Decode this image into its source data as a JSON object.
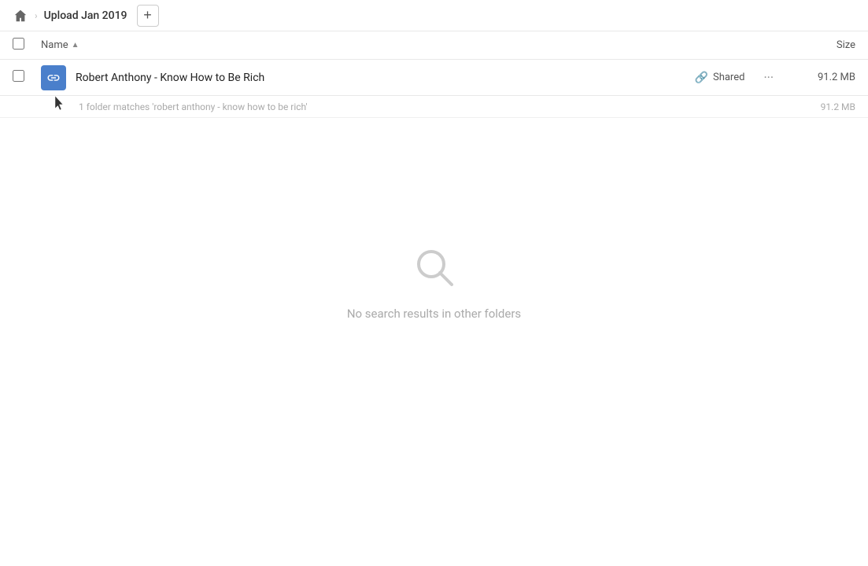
{
  "header": {
    "home_icon": "home",
    "breadcrumb": "Upload Jan 2019",
    "add_button_label": "+"
  },
  "columns": {
    "name_label": "Name",
    "size_label": "Size",
    "sort_indicator": "▲"
  },
  "file_row": {
    "name": "Robert Anthony - Know How to Be Rich",
    "shared_label": "Shared",
    "more_label": "···",
    "size": "91.2 MB",
    "icon_type": "link-folder"
  },
  "match_row": {
    "text": "1 folder matches 'robert anthony - know how to be rich'",
    "size": "91.2 MB"
  },
  "empty_state": {
    "message": "No search results in other folders"
  }
}
